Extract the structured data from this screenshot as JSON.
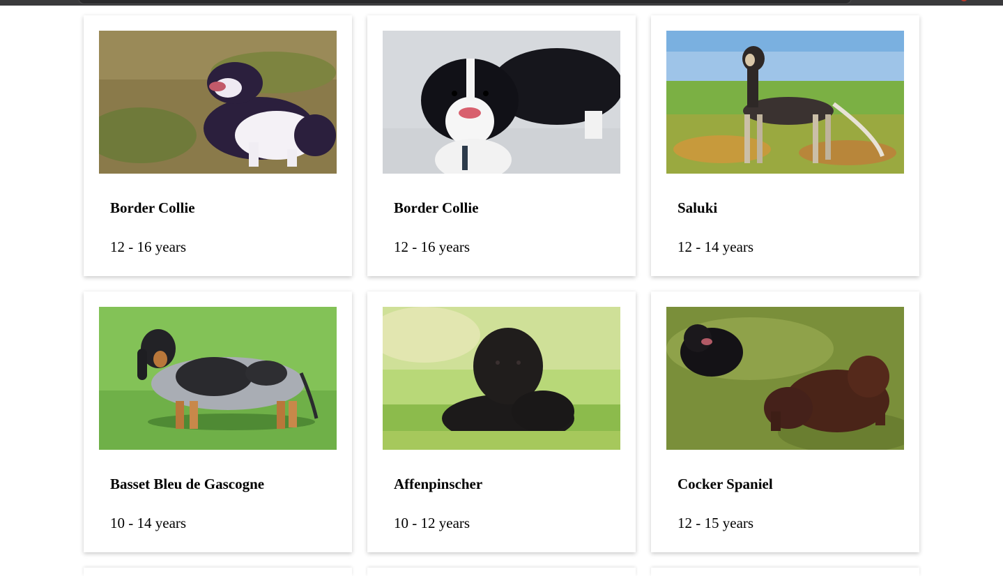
{
  "dogs": [
    {
      "breed": "Border Collie",
      "life_span": "12 - 16 years",
      "photo_icon": "dog-photo-border-collie-grass"
    },
    {
      "breed": "Border Collie",
      "life_span": "12 - 16 years",
      "photo_icon": "dog-photo-border-collie-pavement"
    },
    {
      "breed": "Saluki",
      "life_span": "12 - 14 years",
      "photo_icon": "dog-photo-saluki-field"
    },
    {
      "breed": "Basset Bleu de Gascogne",
      "life_span": "10 - 14 years",
      "photo_icon": "dog-photo-basset-lawn"
    },
    {
      "breed": "Affenpinscher",
      "life_span": "10 - 12 years",
      "photo_icon": "dog-photo-affenpinscher-grass"
    },
    {
      "breed": "Cocker Spaniel",
      "life_span": "12 - 15 years",
      "photo_icon": "dog-photo-cocker-spaniels-grass"
    }
  ],
  "colors": {
    "card_background": "#ffffff",
    "text": "#000000",
    "browser_bar": "#3a3a3c"
  }
}
